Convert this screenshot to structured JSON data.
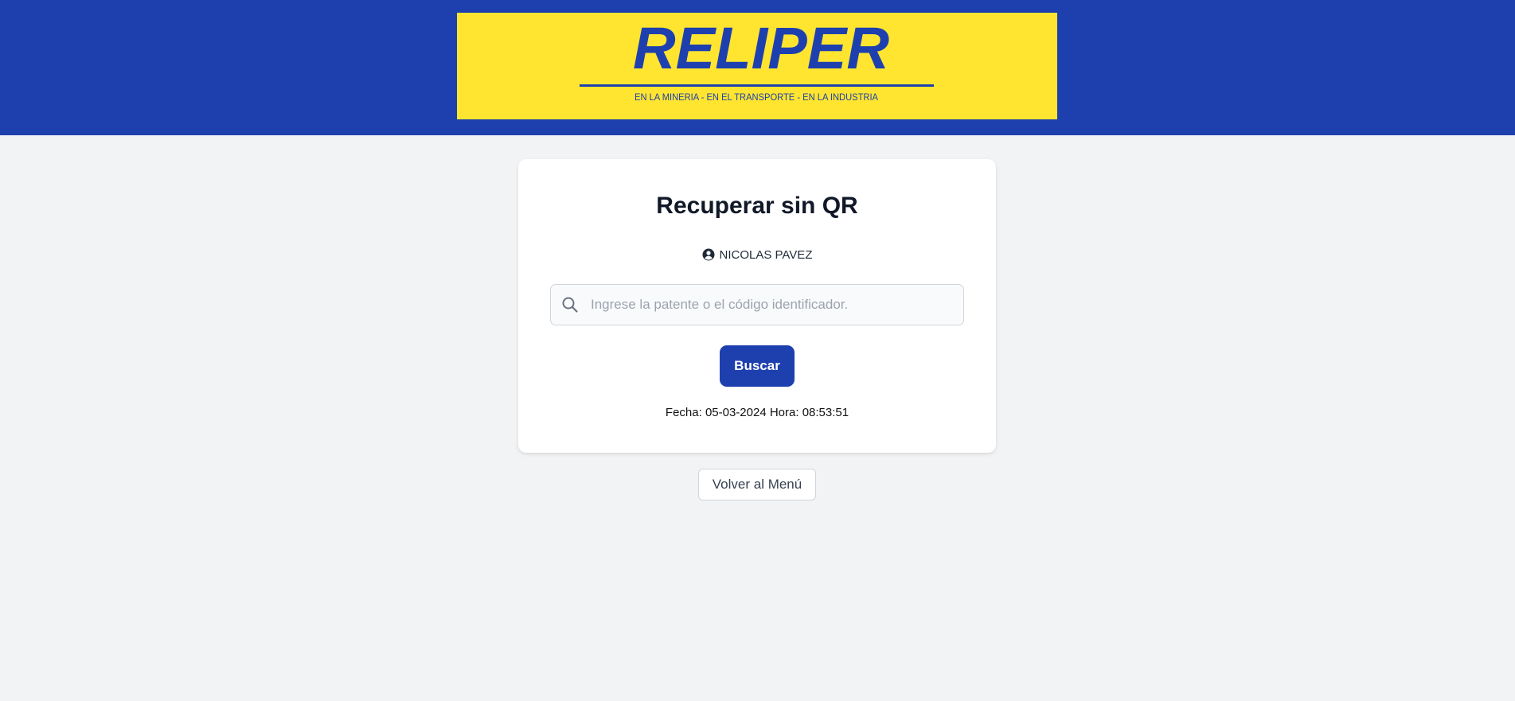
{
  "header": {
    "logo_text": "RELIPER",
    "logo_tagline": "EN LA MINERIA - EN EL TRANSPORTE - EN LA INDUSTRIA",
    "background_color": "#1e40af",
    "logo_background_color": "#ffe52f"
  },
  "card": {
    "title": "Recuperar sin QR",
    "user_icon": "user-circle-icon",
    "user_name": "NICOLAS PAVEZ",
    "search": {
      "icon": "search-icon",
      "value": "",
      "placeholder": "Ingrese la patente o el código identificador."
    },
    "search_button_label": "Buscar",
    "datetime_text": "Fecha: 05-03-2024 Hora: 08:53:51"
  },
  "back_button_label": "Volver al Menú",
  "colors": {
    "accent": "#1e40af",
    "page_background": "#f2f3f5"
  }
}
